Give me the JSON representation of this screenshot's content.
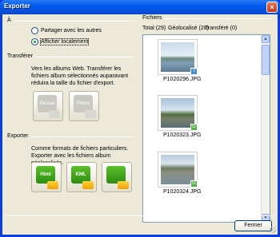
{
  "window": {
    "title": "Exporter",
    "close_label": "×"
  },
  "a": {
    "heading": "À",
    "options": [
      {
        "label": "Partager avec les autres",
        "selected": false
      },
      {
        "label": "Afficher localement",
        "selected": true
      }
    ]
  },
  "transferer": {
    "heading": "Transférer",
    "description": "Vers les albums Web. Transférer les fichiers album sélectionnés auparavant réduira la taille du fichier d'export.",
    "buttons": [
      {
        "label": "Picasa",
        "icon": "picasa-upload-icon"
      },
      {
        "label": "Flickr",
        "icon": "flickr-upload-icon"
      }
    ]
  },
  "exporter": {
    "heading": "Exporter",
    "description": "Comme formats de fichiers particuliers. Exporter avec les fichiers album géolocalisés.",
    "buttons": [
      {
        "label": "Html",
        "icon": "html-export-icon"
      },
      {
        "label": "KML",
        "icon": "kml-export-icon"
      },
      {
        "label": "",
        "icon": "folder-export-icon"
      }
    ]
  },
  "fichiers": {
    "heading": "Fichiers",
    "stats": [
      "Total (29)",
      "Géolocalisé (28)",
      "Transféré (0)"
    ],
    "items": [
      {
        "name": "P1020296.JPG",
        "badge": "?"
      },
      {
        "name": "P1020323.JPG",
        "badge": "G"
      },
      {
        "name": "P1020324.JPG",
        "badge": "G"
      }
    ]
  },
  "footer": {
    "ok_label": "Fermer"
  }
}
